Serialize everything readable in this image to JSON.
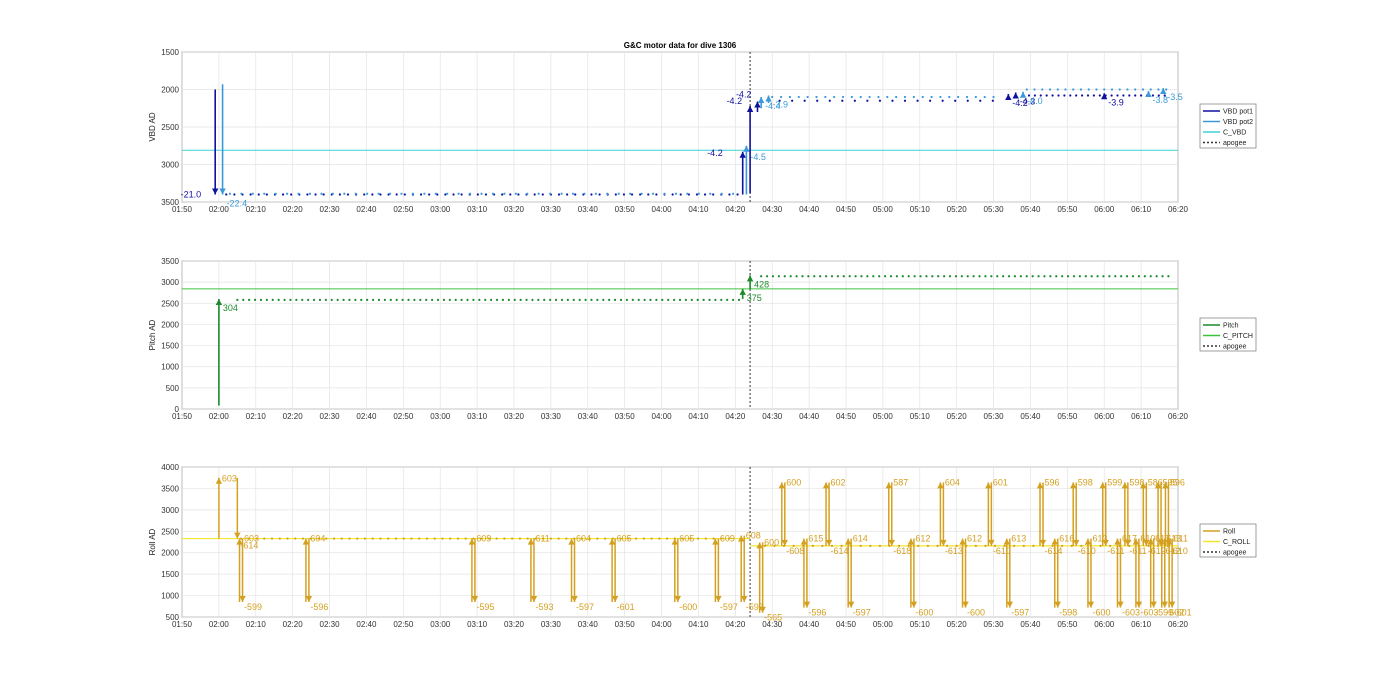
{
  "figure_title": "G&C motor data for dive 1306",
  "chart_data": [
    {
      "type": "line",
      "ylabel": "VBD AD",
      "ylim": [
        3500,
        1500
      ],
      "y_reversed": true,
      "yticks": [
        "1500",
        "2000",
        "2500",
        "3000",
        "3500"
      ],
      "xlim": [
        "01:50",
        "06:20"
      ],
      "xticks": [
        "01:50",
        "02:00",
        "02:10",
        "02:20",
        "02:30",
        "02:40",
        "02:50",
        "03:00",
        "03:10",
        "03:20",
        "03:30",
        "03:40",
        "03:50",
        "04:00",
        "04:10",
        "04:20",
        "04:30",
        "04:40",
        "04:50",
        "05:00",
        "05:10",
        "05:20",
        "05:30",
        "05:40",
        "05:50",
        "06:00",
        "06:10",
        "06:20"
      ],
      "grid": true,
      "legend_position": "right",
      "apogee": "04:24",
      "series": [
        {
          "name": "VBD pot1",
          "color": "#1010a0"
        },
        {
          "name": "VBD pot2",
          "color": "#3a9ad9"
        },
        {
          "name": "C_VBD",
          "color": "#3fd0d8",
          "constant": 2810
        },
        {
          "name": "apogee",
          "color": "#333333",
          "style": "dotted"
        }
      ],
      "steps": [
        {
          "t": "01:59",
          "from": 2000,
          "to": 3400,
          "series": "VBD pot1",
          "label": "-21.0",
          "label_color": "#1010a0"
        },
        {
          "t": "02:01",
          "from": 1930,
          "to": 3400,
          "series": "VBD pot2",
          "label": "-22.4",
          "label_color": "#3a9ad9"
        },
        {
          "t": "04:22",
          "from": 3400,
          "to": 2830,
          "series": "VBD pot1",
          "label": "-4.2",
          "label_color": "#1010a0"
        },
        {
          "t": "04:23",
          "from": 3400,
          "to": 2750,
          "series": "VBD pot2",
          "label": "-4.5",
          "label_color": "#3a9ad9"
        },
        {
          "t": "04:24",
          "from": 3380,
          "to": 2220,
          "series": "VBD pot1",
          "label": "-4.2",
          "label_color": "#1010a0"
        },
        {
          "t": "04:26",
          "from": 2300,
          "to": 2160,
          "series": "VBD pot1",
          "label": "-4.2",
          "label_color": "#1010a0"
        },
        {
          "t": "04:27",
          "from": 2250,
          "to": 2100,
          "series": "VBD pot2",
          "label": "-4.4",
          "label_color": "#3a9ad9"
        },
        {
          "t": "04:29",
          "from": 2180,
          "to": 2080,
          "series": "VBD pot2",
          "label": "-3.9",
          "label_color": "#3a9ad9"
        },
        {
          "t": "05:34",
          "from": 2130,
          "to": 2060,
          "series": "VBD pot1",
          "label": "-4.2",
          "label_color": "#1010a0"
        },
        {
          "t": "05:36",
          "from": 2100,
          "to": 2040,
          "series": "VBD pot1",
          "label": "-4.3",
          "label_color": "#1010a0"
        },
        {
          "t": "05:38",
          "from": 2090,
          "to": 2030,
          "series": "VBD pot2",
          "label": "-4.0",
          "label_color": "#3a9ad9"
        },
        {
          "t": "06:00",
          "from": 2100,
          "to": 2050,
          "series": "VBD pot1",
          "label": "-3.9",
          "label_color": "#1010a0"
        },
        {
          "t": "06:12",
          "from": 2080,
          "to": 2020,
          "series": "VBD pot2",
          "label": "-3.8",
          "label_color": "#3a9ad9"
        },
        {
          "t": "06:16",
          "from": 2030,
          "to": 1980,
          "series": "VBD pot2",
          "label": "-3.5",
          "label_color": "#3a9ad9"
        }
      ]
    },
    {
      "type": "line",
      "ylabel": "Pitch AD",
      "ylim": [
        0,
        3500
      ],
      "yticks": [
        "0",
        "500",
        "1000",
        "1500",
        "2000",
        "2500",
        "3000",
        "3500"
      ],
      "xlim": [
        "01:50",
        "06:20"
      ],
      "xticks": [
        "01:50",
        "02:00",
        "02:10",
        "02:20",
        "02:30",
        "02:40",
        "02:50",
        "03:00",
        "03:10",
        "03:20",
        "03:30",
        "03:40",
        "03:50",
        "04:00",
        "04:10",
        "04:20",
        "04:30",
        "04:40",
        "04:50",
        "05:00",
        "05:10",
        "05:20",
        "05:30",
        "05:40",
        "05:50",
        "06:00",
        "06:10",
        "06:20"
      ],
      "grid": true,
      "legend_position": "right",
      "apogee": "04:24",
      "series": [
        {
          "name": "Pitch",
          "color": "#1a8a2a"
        },
        {
          "name": "C_PITCH",
          "color": "#3ac43a",
          "constant": 2840
        },
        {
          "name": "apogee",
          "color": "#333333",
          "style": "dotted"
        }
      ],
      "steps": [
        {
          "t": "02:00",
          "from": 80,
          "to": 2600,
          "label": "304"
        },
        {
          "t": "04:22",
          "from": 2600,
          "to": 2840,
          "label": "375"
        },
        {
          "t": "04:24",
          "from": 2840,
          "to": 3160,
          "label": "428"
        }
      ]
    },
    {
      "type": "line",
      "ylabel": "Roll AD",
      "ylim": [
        500,
        4000
      ],
      "yticks": [
        "500",
        "1000",
        "1500",
        "2000",
        "2500",
        "3000",
        "3500",
        "4000"
      ],
      "xlim": [
        "01:50",
        "06:20"
      ],
      "xticks": [
        "01:50",
        "02:00",
        "02:10",
        "02:20",
        "02:30",
        "02:40",
        "02:50",
        "03:00",
        "03:10",
        "03:20",
        "03:30",
        "03:40",
        "03:50",
        "04:00",
        "04:10",
        "04:20",
        "04:30",
        "04:40",
        "04:50",
        "05:00",
        "05:10",
        "05:20",
        "05:30",
        "05:40",
        "05:50",
        "06:00",
        "06:10",
        "06:20"
      ],
      "grid": true,
      "legend_position": "right",
      "apogee": "04:24",
      "series": [
        {
          "name": "Roll",
          "color": "#d4a020"
        },
        {
          "name": "C_ROLL",
          "color": "#f2e630",
          "constant_before": 2330,
          "constant_after": 2160
        },
        {
          "name": "apogee",
          "color": "#333333",
          "style": "dotted"
        }
      ],
      "pulses": [
        {
          "t": "02:00",
          "to": 3750,
          "label": "603",
          "base": 2330
        },
        {
          "t": "02:05",
          "to": 2330,
          "label": "-614",
          "base": 3750,
          "down": true
        },
        {
          "t": "02:06",
          "to": 2330,
          "label": "603",
          "base": 850,
          "down": false,
          "pair_low": 850,
          "low_label": "-599"
        },
        {
          "t": "02:24",
          "to": 2330,
          "label": "604",
          "pair_low": 850,
          "low_label": "-596"
        },
        {
          "t": "03:09",
          "to": 2330,
          "label": "609",
          "pair_low": 850,
          "low_label": "-595"
        },
        {
          "t": "03:25",
          "to": 2330,
          "label": "611",
          "pair_low": 850,
          "low_label": "-593"
        },
        {
          "t": "03:36",
          "to": 2330,
          "label": "604",
          "pair_low": 850,
          "low_label": "-597"
        },
        {
          "t": "03:47",
          "to": 2330,
          "label": "605",
          "pair_low": 850,
          "low_label": "-601"
        },
        {
          "t": "04:04",
          "to": 2330,
          "label": "605",
          "pair_low": 850,
          "low_label": "-600"
        },
        {
          "t": "04:15",
          "to": 2330,
          "label": "609",
          "pair_low": 850,
          "low_label": "-597"
        },
        {
          "t": "04:22",
          "to": 2400,
          "label": "608",
          "pair_low": 850,
          "low_label": "-597"
        },
        {
          "t": "04:27",
          "to": 2240,
          "label": "600",
          "pair_low": 600,
          "low_label": "-565"
        },
        {
          "t": "04:33",
          "to": 3640,
          "label": "600",
          "pair_low": 2160,
          "low_label": "-608"
        },
        {
          "t": "04:39",
          "to": 2330,
          "label": "615",
          "pair_low": 720,
          "low_label": "-596"
        },
        {
          "t": "04:45",
          "to": 3640,
          "label": "602",
          "pair_low": 2160,
          "low_label": "-614"
        },
        {
          "t": "04:51",
          "to": 2330,
          "label": "614",
          "pair_low": 720,
          "low_label": "-597"
        },
        {
          "t": "05:02",
          "to": 3640,
          "label": "587",
          "pair_low": 2160,
          "low_label": "-618"
        },
        {
          "t": "05:08",
          "to": 2330,
          "label": "612",
          "pair_low": 720,
          "low_label": "-600"
        },
        {
          "t": "05:16",
          "to": 3640,
          "label": "604",
          "pair_low": 2160,
          "low_label": "-613"
        },
        {
          "t": "05:22",
          "to": 2330,
          "label": "612",
          "pair_low": 720,
          "low_label": "-600"
        },
        {
          "t": "05:29",
          "to": 3640,
          "label": "601",
          "pair_low": 2160,
          "low_label": "-610"
        },
        {
          "t": "05:34",
          "to": 2330,
          "label": "613",
          "pair_low": 720,
          "low_label": "-597"
        },
        {
          "t": "05:43",
          "to": 3640,
          "label": "596",
          "pair_low": 2160,
          "low_label": "-614"
        },
        {
          "t": "05:47",
          "to": 2330,
          "label": "616",
          "pair_low": 720,
          "low_label": "-598"
        },
        {
          "t": "05:52",
          "to": 3640,
          "label": "598",
          "pair_low": 2160,
          "low_label": "-610"
        },
        {
          "t": "05:56",
          "to": 2330,
          "label": "613",
          "pair_low": 720,
          "low_label": "-600"
        },
        {
          "t": "06:00",
          "to": 3640,
          "label": "599",
          "pair_low": 2160,
          "low_label": "-611"
        },
        {
          "t": "06:04",
          "to": 2330,
          "label": "617",
          "pair_low": 720,
          "low_label": "-603"
        },
        {
          "t": "06:06",
          "to": 3640,
          "label": "598",
          "pair_low": 2160,
          "low_label": "-611"
        },
        {
          "t": "06:09",
          "to": 2330,
          "label": "610",
          "pair_low": 720,
          "low_label": "-603"
        },
        {
          "t": "06:11",
          "to": 3640,
          "label": "586",
          "pair_low": 2160,
          "low_label": "-619"
        },
        {
          "t": "06:13",
          "to": 2330,
          "label": "617",
          "pair_low": 720,
          "low_label": "-599"
        },
        {
          "t": "06:15",
          "to": 3640,
          "label": "595",
          "pair_low": 2160,
          "low_label": "-612"
        },
        {
          "t": "06:16",
          "to": 2330,
          "label": "613",
          "pair_low": 720,
          "low_label": "-602"
        },
        {
          "t": "06:17",
          "to": 3640,
          "label": "596",
          "pair_low": 2160,
          "low_label": "-610"
        },
        {
          "t": "06:18",
          "to": 2330,
          "label": "611",
          "pair_low": 720,
          "low_label": "-601"
        }
      ]
    }
  ]
}
